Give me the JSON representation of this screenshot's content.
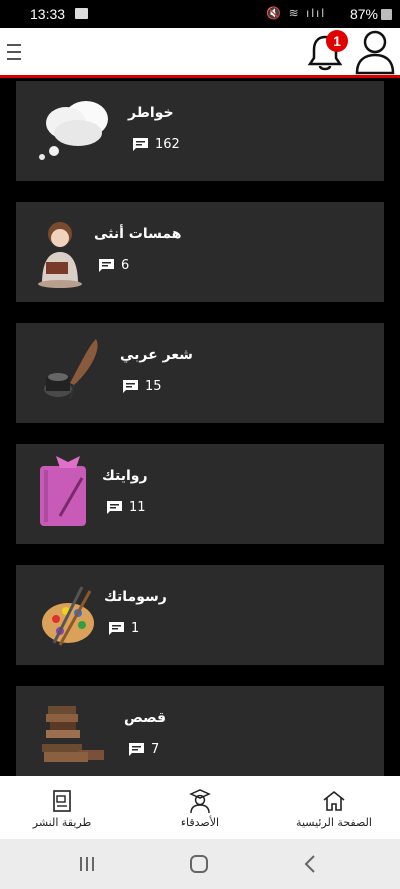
{
  "status_bar": {
    "time": "13:33",
    "system_icons": "🔇 ≋ ılıl",
    "battery": "87%"
  },
  "header": {
    "notification_count": "1",
    "accent_color": "#d40000"
  },
  "categories": [
    {
      "title": "خواطر",
      "count": "162",
      "icon": "thought-cloud-icon"
    },
    {
      "title": "همسات أنثى",
      "count": "6",
      "icon": "reading-girl-icon"
    },
    {
      "title": "شعر عربي",
      "count": "15",
      "icon": "quill-inkwell-icon"
    },
    {
      "title": "روايتك",
      "count": "11",
      "icon": "pink-notebook-icon"
    },
    {
      "title": "رسوماتك",
      "count": "1",
      "icon": "paint-palette-icon"
    },
    {
      "title": "قصص",
      "count": "7",
      "icon": "book-stack-icon"
    }
  ],
  "bottom_nav": {
    "home_label": "الصفحة الرئيسية",
    "friends_label": "الأصدقاء",
    "publish_label": "طريقة النشر"
  }
}
